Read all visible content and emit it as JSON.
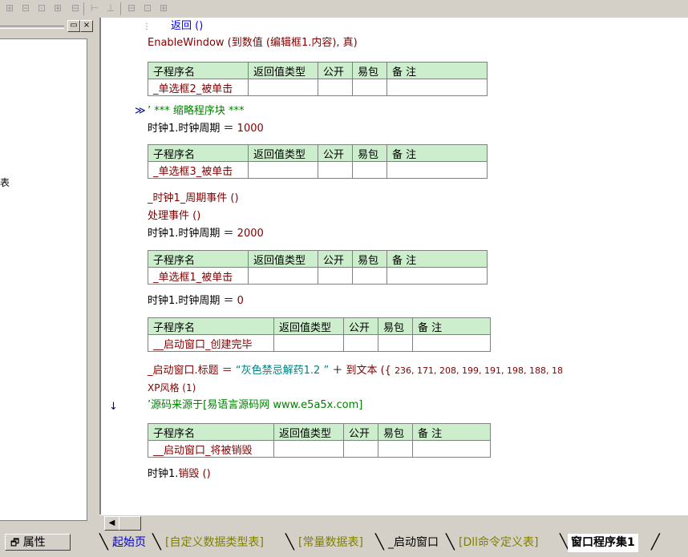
{
  "toolbar": {
    "icons": [
      "align-left-icon",
      "align-center-icon",
      "align-right-icon",
      "align-top-icon",
      "distribute-h-icon",
      "distribute-v-icon",
      "same-width-icon",
      "same-height-icon",
      "same-size-icon"
    ]
  },
  "left_panel": {
    "tree_fragment": "表",
    "minimize_label": "▭",
    "close_label": "×"
  },
  "code": {
    "line_return": "返回 ()",
    "line_enablewindow": "EnableWindow (到数值 (编辑框1.内容), 真)",
    "table_headers": [
      "子程序名",
      "返回值类型",
      "公开",
      "易包",
      "备 注"
    ],
    "sub1_name": "_单选框2_被单击",
    "collapsed_marker": "≫",
    "collapsed_text": "’ *** 缩略程序块 ***",
    "line_timer_1000_prefix": "时钟1.时钟周期 ＝ ",
    "line_timer_1000_val": "1000",
    "sub2_name": "_单选框3_被单击",
    "line_timer_event": "_时钟1_周期事件 ()",
    "line_process": "处理事件 ()",
    "line_timer_2000_prefix": "时钟1.时钟周期 ＝ ",
    "line_timer_2000_val": "2000",
    "sub3_name": "_单选框1_被单击",
    "line_timer_0_prefix": "时钟1.时钟周期 ＝ ",
    "line_timer_0_val": "0",
    "sub4_name": "__启动窗口_创建完毕",
    "line_title_prefix": "_启动窗口.标题 ＝ ",
    "line_title_str": "“灰色禁忌解药1.2  ”",
    "line_title_plus": " ＋ ",
    "line_title_fn": "到文本 ({ ",
    "line_title_nums": "236, 171, 208, 199, 191, 198, 188, 18",
    "line_xp": "XP风格 (1)",
    "comment_arrow": "↓",
    "comment_line": "’源码来源于[易语言源码网 www.e5a5x.com]",
    "sub5_name": "__启动窗口_将被销毁",
    "line_destroy_prefix": "时钟1.",
    "line_destroy_fn": "销毁 ()"
  },
  "bottom": {
    "properties_label": "属性",
    "tabs": [
      "起始页",
      "[自定义数据类型表]",
      "[常量数据表]",
      "_启动窗口",
      "[Dll命令定义表]",
      "窗口程序集1"
    ]
  },
  "colors": {
    "header_bg": "#cceecc",
    "keyword": "#800000",
    "comment": "#008000",
    "panel_bg": "#d4d0c8"
  }
}
